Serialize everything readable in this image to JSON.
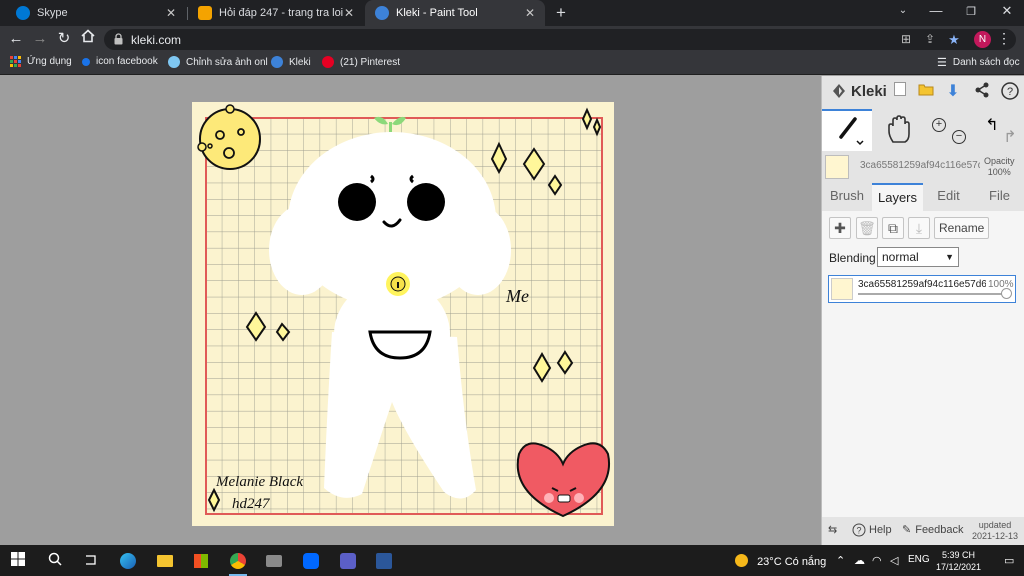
{
  "tabs": [
    {
      "title": "Skype",
      "color": "#0078d4",
      "active": false
    },
    {
      "title": "Hỏi đáp 247 - trang tra loi",
      "color": "#f4a300",
      "active": false
    },
    {
      "title": "Kleki - Paint Tool",
      "color": "#3d82d8",
      "active": true
    }
  ],
  "address": {
    "url": "kleki.com"
  },
  "profile_initial": "N",
  "bookmarks": [
    {
      "label": "Ứng dụng",
      "icon": "apps-icon"
    },
    {
      "label": "icon facebook",
      "icon": "facebook-icon"
    },
    {
      "label": "Chỉnh sửa ảnh onl",
      "icon": "photo-edit-icon"
    },
    {
      "label": "Kleki",
      "icon": "kleki-icon"
    },
    {
      "label": "(21) Pinterest",
      "icon": "pinterest-icon"
    }
  ],
  "reading_list": "Danh sách đọc",
  "drawing": {
    "text_me": "Me",
    "signature_line1": "Melanie Black",
    "signature_line2": "hd247"
  },
  "kleki": {
    "logo": "Kleki",
    "layer_id": "3ca65581259af94c116e57d6",
    "opacity_label": "Opacity",
    "opacity_value": "100%",
    "tabs": [
      "Brush",
      "Layers",
      "Edit",
      "File"
    ],
    "active_tab": "Layers",
    "rename_label": "Rename",
    "blending_label": "Blending",
    "blending_value": "normal",
    "layer_opacity": "100%",
    "help_label": "Help",
    "feedback_label": "Feedback",
    "updated_label": "updated",
    "updated_date": "2021-12-13"
  },
  "taskbar": {
    "weather": "23°C  Có nắng",
    "language": "ENG",
    "time": "5:39 CH",
    "date": "17/12/2021"
  },
  "colors": {
    "chrome_dark": "#202124",
    "chrome_toolbar": "#35363a",
    "paper": "#fbf3cf",
    "grid_line": "#9d9d8f",
    "border_red": "#e05a57",
    "accent_blue": "#3d82d8",
    "heart_red": "#f05a63"
  }
}
